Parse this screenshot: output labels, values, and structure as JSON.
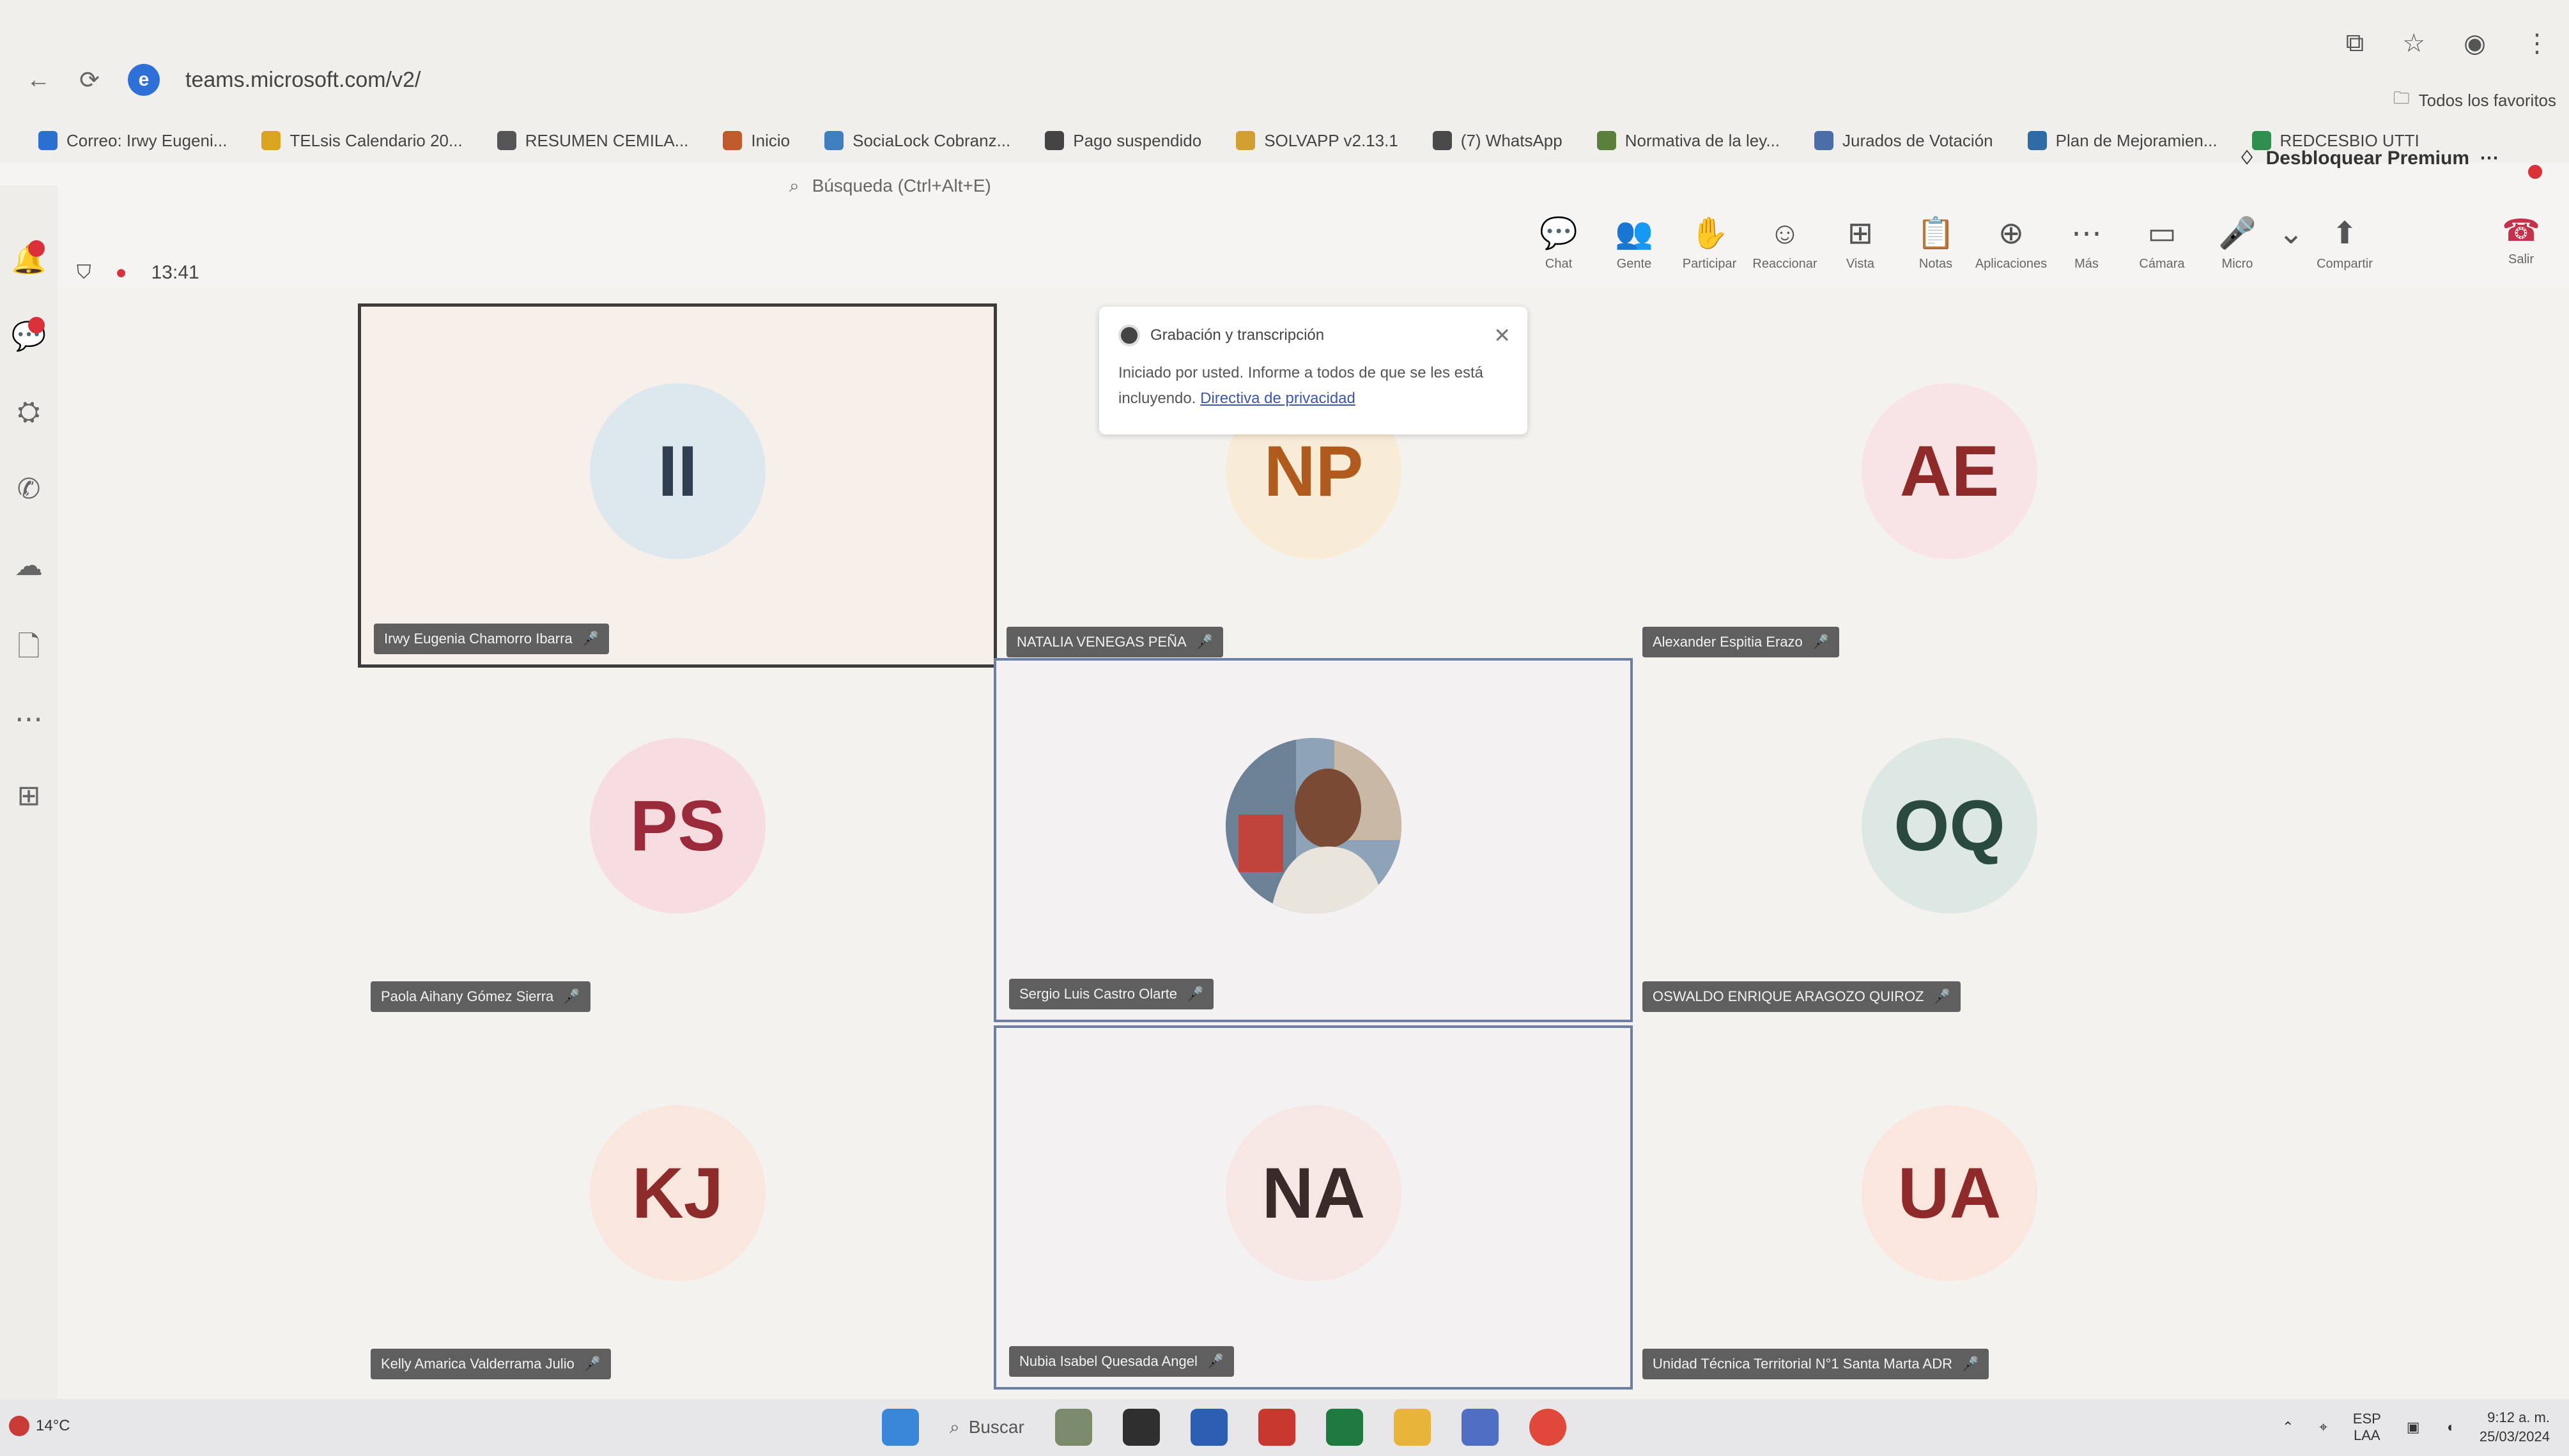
{
  "browser": {
    "url": "teams.microsoft.com/v2/",
    "all_bookmarks_label": "Todos los favoritos",
    "bookmarks": [
      {
        "label": "Correo: Irwy Eugeni...",
        "color": "#2b6fd1"
      },
      {
        "label": "TELsis Calendario 20...",
        "color": "#d9a520"
      },
      {
        "label": "RESUMEN CEMILA...",
        "color": "#555555"
      },
      {
        "label": "Inicio",
        "color": "#c05a2a"
      },
      {
        "label": "SociaLock Cobranz...",
        "color": "#3f7fbf"
      },
      {
        "label": "Pago suspendido",
        "color": "#444444"
      },
      {
        "label": "SOLVAPP v2.13.1",
        "color": "#d2a030"
      },
      {
        "label": "(7) WhatsApp",
        "color": "#4a4a4a"
      },
      {
        "label": "Normativa de la ley...",
        "color": "#5b7f3c"
      },
      {
        "label": "Jurados de Votación",
        "color": "#4c6ea8"
      },
      {
        "label": "Plan de Mejoramien...",
        "color": "#2e6aa5"
      },
      {
        "label": "REDCESBIO UTTI",
        "color": "#2f8f4e"
      }
    ]
  },
  "teams": {
    "search_hint": "Búsqueda (Ctrl+Alt+E)",
    "premium_label": "Desbloquear Premium",
    "meeting_time": "13:41",
    "toolbar": [
      {
        "icon": "chat-icon",
        "glyph": "💬",
        "label": "Chat"
      },
      {
        "icon": "people-icon",
        "glyph": "👥",
        "label": "Gente"
      },
      {
        "icon": "raise-hand-icon",
        "glyph": "✋",
        "label": "Participar"
      },
      {
        "icon": "react-icon",
        "glyph": "☺",
        "label": "Reaccionar"
      },
      {
        "icon": "view-icon",
        "glyph": "⊞",
        "label": "Vista"
      },
      {
        "icon": "notes-icon",
        "glyph": "📋",
        "label": "Notas"
      },
      {
        "icon": "apps-icon",
        "glyph": "⊕",
        "label": "Aplicaciones"
      },
      {
        "icon": "more-icon",
        "glyph": "⋯",
        "label": "Más"
      },
      {
        "icon": "camera-off-icon",
        "glyph": "▭",
        "label": "Cámara"
      },
      {
        "icon": "mic-icon",
        "glyph": "🎤",
        "label": "Micro"
      },
      {
        "icon": "chevron-down-icon",
        "glyph": "⌄",
        "label": ""
      },
      {
        "icon": "share-icon",
        "glyph": "⬆",
        "label": "Compartir"
      }
    ],
    "leave_label": "Salir",
    "recording_banner": {
      "title": "Grabación y transcripción",
      "body": "Iniciado por usted. Informe a todos de que se les está incluyendo.",
      "link": "Directiva de privacidad"
    }
  },
  "participants": [
    {
      "initials": "II",
      "name": "Irwy Eugenia Chamorro Ibarra",
      "avatar_bg": "#dde8ee",
      "avatar_fg": "#2f3f4f"
    },
    {
      "initials": "NP",
      "name": "NATALIA VENEGAS PEÑA",
      "avatar_bg": "#f8ecd6",
      "avatar_fg": "#b05a1e"
    },
    {
      "initials": "AE",
      "name": "Alexander Espitia Erazo",
      "avatar_bg": "#f8e4e4",
      "avatar_fg": "#8e2a2a"
    },
    {
      "initials": "PS",
      "name": "Paola Aihany Gómez Sierra",
      "avatar_bg": "#f8dde0",
      "avatar_fg": "#9b2a3a"
    },
    {
      "initials": "",
      "name": "Sergio Luis Castro Olarte",
      "avatar_bg": "#ffffff",
      "avatar_fg": "#333333"
    },
    {
      "initials": "OQ",
      "name": "OSWALDO ENRIQUE ARAGOZO QUIROZ",
      "avatar_bg": "#dde8e4",
      "avatar_fg": "#2a4a40"
    },
    {
      "initials": "KJ",
      "name": "Kelly Amarica Valderrama Julio",
      "avatar_bg": "#f9e6dc",
      "avatar_fg": "#8d2b2b"
    },
    {
      "initials": "NA",
      "name": "Nubia Isabel Quesada Angel",
      "avatar_bg": "#f6e6e4",
      "avatar_fg": "#3a2a2a"
    },
    {
      "initials": "UA",
      "name": "Unidad Técnica Territorial N°1 Santa Marta ADR",
      "avatar_bg": "#fae6dc",
      "avatar_fg": "#8e2a2a"
    }
  ],
  "taskbar": {
    "weather": "14°C",
    "search_label": "Buscar",
    "lang": "ESP",
    "lang_sub": "LAA",
    "time": "9:12 a. m.",
    "date": "25/03/2024"
  }
}
